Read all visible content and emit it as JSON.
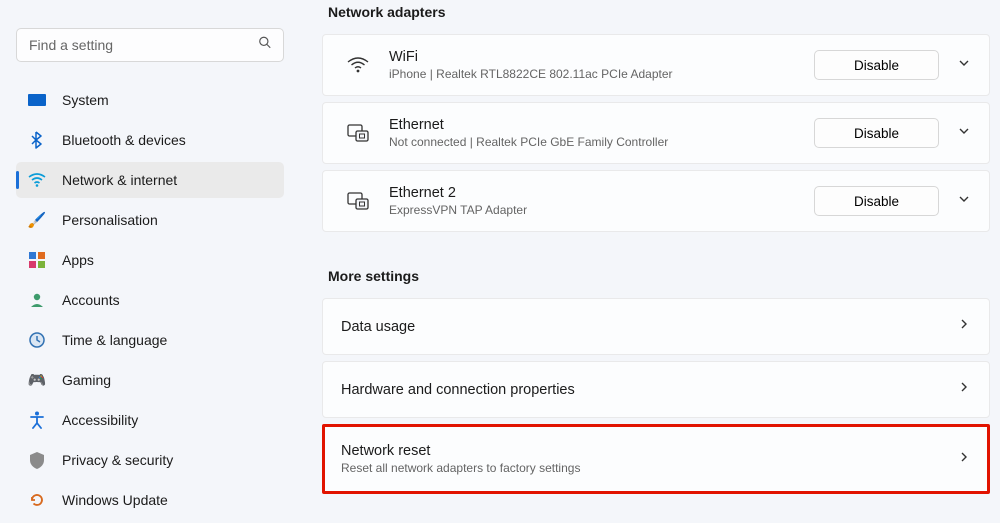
{
  "search": {
    "placeholder": "Find a setting"
  },
  "sidebar": {
    "items": [
      {
        "icon": "💻",
        "label": "System"
      },
      {
        "icon": "bt",
        "label": "Bluetooth & devices"
      },
      {
        "icon": "wifi",
        "label": "Network & internet",
        "active": true
      },
      {
        "icon": "🖌️",
        "label": "Personalisation"
      },
      {
        "icon": "apps",
        "label": "Apps"
      },
      {
        "icon": "👤",
        "label": "Accounts"
      },
      {
        "icon": "🕒",
        "label": "Time & language"
      },
      {
        "icon": "🎮",
        "label": "Gaming"
      },
      {
        "icon": "acc",
        "label": "Accessibility"
      },
      {
        "icon": "🛡️",
        "label": "Privacy & security"
      },
      {
        "icon": "🔄",
        "label": "Windows Update"
      }
    ]
  },
  "sections": {
    "adapters_head": "Network adapters",
    "more_head": "More settings"
  },
  "adapters": [
    {
      "icon": "wifi",
      "name": "WiFi",
      "desc": "iPhone | Realtek RTL8822CE 802.11ac PCIe Adapter",
      "action": "Disable"
    },
    {
      "icon": "eth",
      "name": "Ethernet",
      "desc": "Not connected | Realtek PCIe GbE Family Controller",
      "action": "Disable"
    },
    {
      "icon": "eth",
      "name": "Ethernet 2",
      "desc": "ExpressVPN TAP Adapter",
      "action": "Disable"
    }
  ],
  "settings": [
    {
      "title": "Data usage"
    },
    {
      "title": "Hardware and connection properties"
    },
    {
      "title": "Network reset",
      "sub": "Reset all network adapters to factory settings",
      "highlight": true
    }
  ]
}
